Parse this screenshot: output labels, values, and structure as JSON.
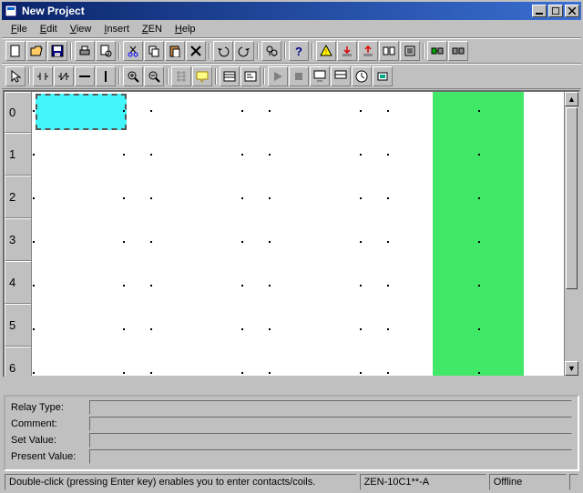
{
  "window": {
    "title": "New Project"
  },
  "menu": {
    "file": "File",
    "edit": "Edit",
    "view": "View",
    "insert": "Insert",
    "zen": "ZEN",
    "help": "Help"
  },
  "rows": {
    "r0": "0",
    "r1": "1",
    "r2": "2",
    "r3": "3",
    "r4": "4",
    "r5": "5",
    "r6": "6"
  },
  "info": {
    "relay_type_label": "Relay Type:",
    "comment_label": "Comment:",
    "set_value_label": "Set Value:",
    "present_value_label": "Present Value:",
    "relay_type": "",
    "comment": "",
    "set_value": "",
    "present_value": ""
  },
  "status": {
    "message": "Double-click (pressing Enter key) enables you to enter contacts/coils.",
    "model": "ZEN-10C1**-A",
    "connection": "Offline"
  }
}
